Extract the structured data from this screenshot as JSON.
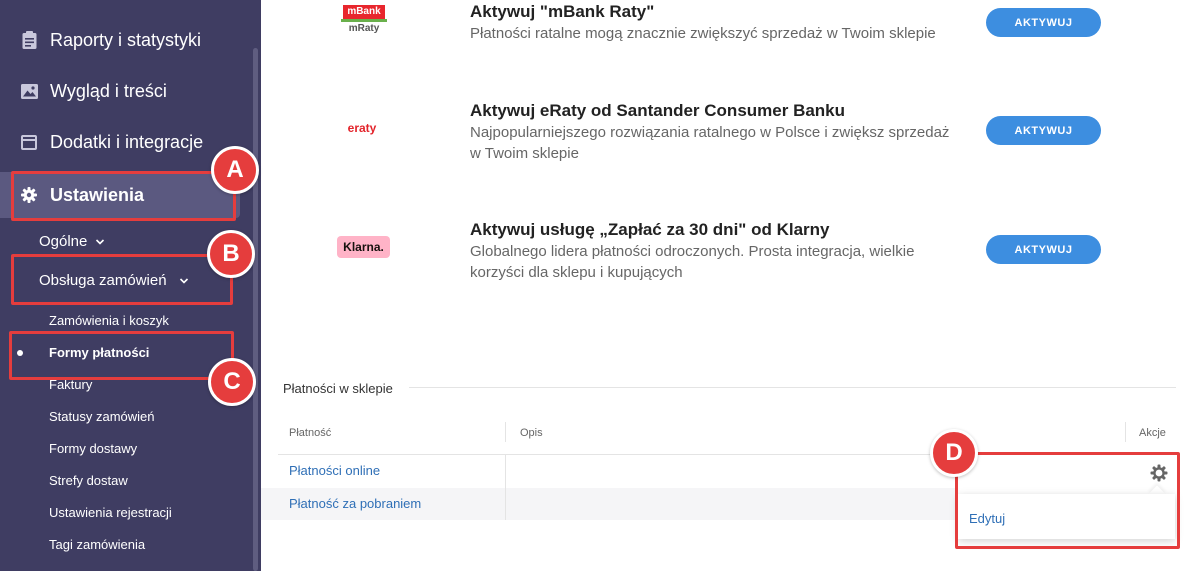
{
  "sidebar": {
    "items": [
      {
        "label": "Raporty i statystyki",
        "icon": "clipboard-icon"
      },
      {
        "label": "Wygląd i treści",
        "icon": "image-icon"
      },
      {
        "label": "Dodatki i integracje",
        "icon": "window-icon"
      },
      {
        "label": "Ustawienia",
        "icon": "gear-icon"
      }
    ],
    "sub": {
      "general": "Ogólne",
      "orders": "Obsługa zamówień",
      "leaves": [
        "Zamówienia i koszyk",
        "Formy płatności",
        "Faktury",
        "Statusy zamówień",
        "Formy dostawy",
        "Strefy dostaw",
        "Ustawienia rejestracji",
        "Tagi zamówienia"
      ]
    }
  },
  "annotations": {
    "a": "A",
    "b": "B",
    "c": "C",
    "d": "D"
  },
  "promos": [
    {
      "logo_top": "mBank",
      "logo_bottom": "mRaty",
      "title": "Aktywuj \"mBank Raty\"",
      "desc": "Płatności ratalne mogą znacznie zwiększyć sprzedaż w Twoim sklepie",
      "button": "AKTYWUJ"
    },
    {
      "logo": "eraty",
      "title": "Aktywuj eRaty od Santander Consumer Banku",
      "desc": "Najpopularniejszego rozwiązania ratalnego w Polsce i zwiększ sprzedaż w Twoim sklepie",
      "button": "AKTYWUJ"
    },
    {
      "logo": "Klarna.",
      "title": "Aktywuj usługę „Zapłać za 30 dni\" od Klarny",
      "desc": "Globalnego lidera płatności odroczonych. Prosta integracja, wielkie korzyści dla sklepu i kupujących",
      "button": "AKTYWUJ"
    }
  ],
  "payments": {
    "section_title": "Płatności w sklepie",
    "columns": [
      "Płatność",
      "Opis",
      "Akcje"
    ],
    "rows": [
      "Płatności online",
      "Płatność za pobraniem"
    ],
    "dropdown": [
      "Edytuj"
    ]
  },
  "colors": {
    "sidebar": "#3f3d62",
    "accent": "#3d8ee0",
    "annotation": "#e53d3d",
    "link": "#2f6fb6"
  }
}
